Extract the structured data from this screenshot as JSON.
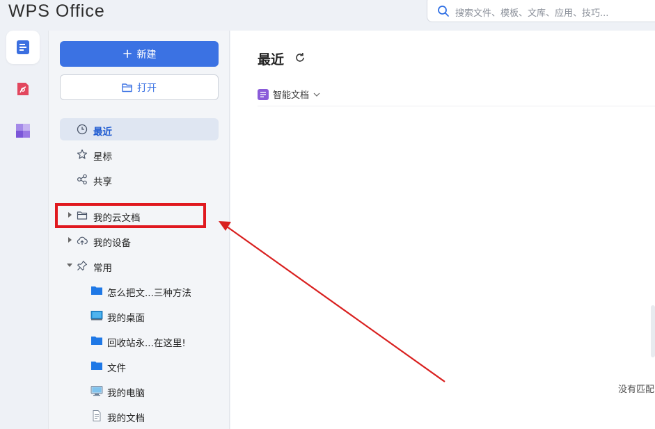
{
  "app": {
    "logo": "WPS Office"
  },
  "search": {
    "placeholder": "搜索文件、模板、文库、应用、技巧..."
  },
  "rail": {
    "items": [
      {
        "icon": "document-icon",
        "active": true
      },
      {
        "icon": "pdf-icon",
        "active": false
      },
      {
        "icon": "apps-icon",
        "active": false
      }
    ]
  },
  "sidebar": {
    "new_label": "新建",
    "open_label": "打开",
    "nav": [
      {
        "label": "最近",
        "icon": "clock-icon",
        "active": true
      },
      {
        "label": "星标",
        "icon": "star-icon",
        "active": false
      },
      {
        "label": "共享",
        "icon": "share-icon",
        "active": false
      }
    ],
    "tree": [
      {
        "label": "我的云文档",
        "icon": "folder-icon",
        "expanded": false
      },
      {
        "label": "我的设备",
        "icon": "cloud-upload-icon",
        "expanded": false
      },
      {
        "label": "常用",
        "icon": "pin-icon",
        "expanded": true
      }
    ],
    "common": [
      {
        "label": "怎么把文...三种方法",
        "icon": "folder-icon"
      },
      {
        "label": "我的桌面",
        "icon": "desktop-icon"
      },
      {
        "label": "回收站永...在这里!",
        "icon": "folder-icon"
      },
      {
        "label": "文件",
        "icon": "folder-icon"
      },
      {
        "label": "我的电脑",
        "icon": "computer-icon"
      },
      {
        "label": "我的文档",
        "icon": "document-file-icon"
      }
    ]
  },
  "main": {
    "title": "最近",
    "filter_label": "智能文档",
    "empty_text": "没有匹配"
  },
  "colors": {
    "accent": "#3b72e3",
    "annotation": "#e0191f",
    "smart_doc": "#8a5bd9"
  }
}
